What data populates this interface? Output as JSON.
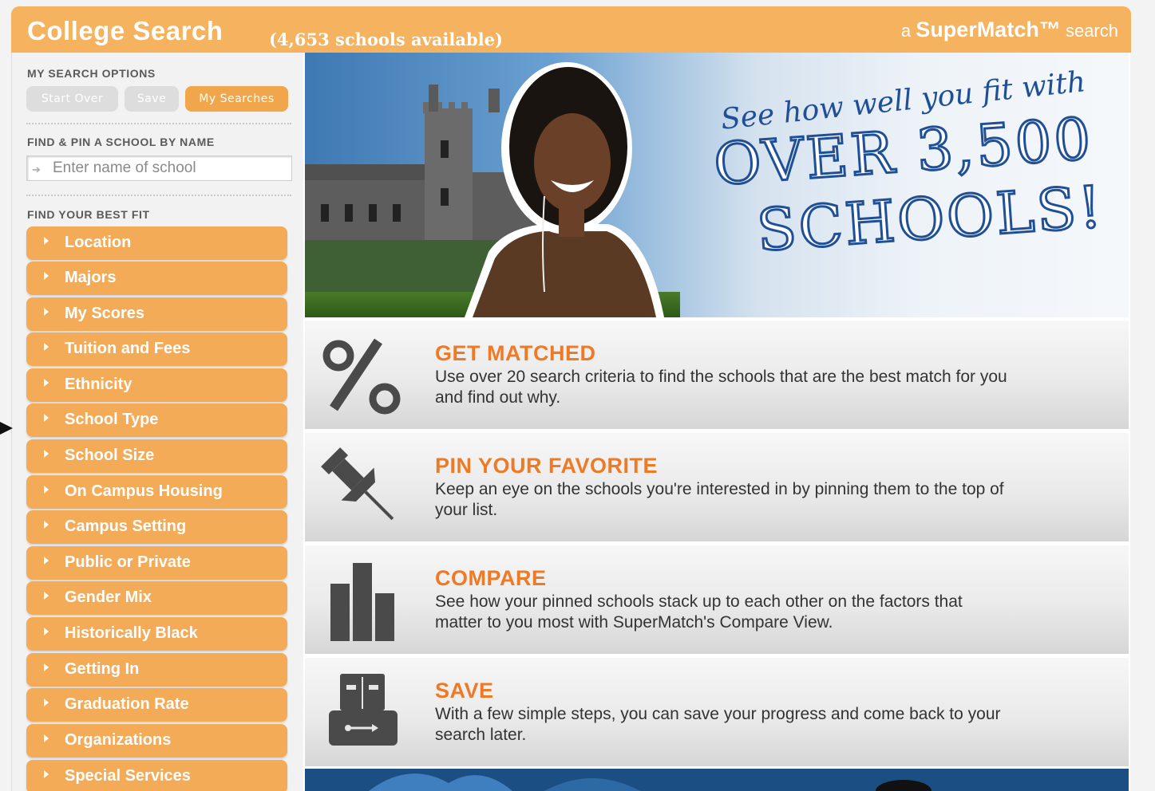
{
  "header": {
    "title": "College Search",
    "count": "(4,653 schools available)",
    "brand_prefix": "a",
    "brand_name": "SuperMatch™",
    "brand_suffix": "search"
  },
  "sidebar": {
    "search_options_heading": "MY SEARCH OPTIONS",
    "buttons": {
      "start_over": "Start Over",
      "save": "Save",
      "my_searches": "My Searches"
    },
    "find_pin_heading": "FIND & PIN A SCHOOL BY NAME",
    "school_name_placeholder": "Enter name of school",
    "best_fit_heading": "FIND YOUR BEST FIT",
    "filters": [
      "Location",
      "Majors",
      "My Scores",
      "Tuition and Fees",
      "Ethnicity",
      "School Type",
      "School Size",
      "On Campus Housing",
      "Campus Setting",
      "Public or Private",
      "Gender Mix",
      "Historically Black",
      "Getting In",
      "Graduation Rate",
      "Organizations",
      "Special Services"
    ]
  },
  "hero": {
    "tagline": "See how well you fit with",
    "headline_line1": "OVER 3,500",
    "headline_line2": "SCHOOLS!"
  },
  "features": [
    {
      "icon": "percent-icon",
      "title": "GET MATCHED",
      "desc": "Use over 20 search criteria to find the schools that are the best match for you and find out why."
    },
    {
      "icon": "pushpin-icon",
      "title": "PIN YOUR FAVORITE",
      "desc": "Keep an eye on the schools you're interested in by pinning them to the top of your list."
    },
    {
      "icon": "bar-chart-icon",
      "title": "COMPARE",
      "desc": "See how your pinned schools stack up to each other on the factors that matter to you most with SuperMatch's Compare View."
    },
    {
      "icon": "usb-drive-icon",
      "title": "SAVE",
      "desc": "With a few simple steps, you can save your progress and come back to your search later."
    }
  ],
  "colors": {
    "accent": "#f5b25f",
    "filter_button": "#f3ab57",
    "feature_title": "#ee7a26",
    "icon_gray": "#4a4a4a",
    "disabled_button": "#dddddd"
  }
}
